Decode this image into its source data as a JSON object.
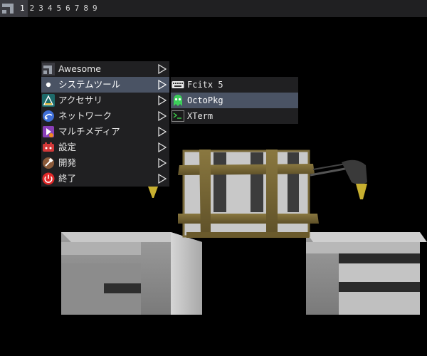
{
  "wibar": {
    "tags": [
      "1",
      "2",
      "3",
      "4",
      "5",
      "6",
      "7",
      "8",
      "9"
    ],
    "active_tag": "1"
  },
  "main_menu": {
    "items": [
      {
        "label": "Awesome",
        "icon": "awesome-icon"
      },
      {
        "label": "システムツール",
        "icon": "bullet-icon"
      },
      {
        "label": "アクセサリ",
        "icon": "accessories-icon"
      },
      {
        "label": "ネットワーク",
        "icon": "network-icon"
      },
      {
        "label": "マルチメディア",
        "icon": "multimedia-icon"
      },
      {
        "label": "設定",
        "icon": "settings-icon"
      },
      {
        "label": "開発",
        "icon": "development-icon"
      },
      {
        "label": "終了",
        "icon": "power-icon"
      }
    ],
    "selected": "システムツール"
  },
  "submenu": {
    "items": [
      {
        "label": "Fcitx 5",
        "icon": "keyboard-icon"
      },
      {
        "label": "OctoPkg",
        "icon": "octopkg-icon"
      },
      {
        "label": "XTerm",
        "icon": "terminal-icon"
      }
    ],
    "selected": "OctoPkg"
  },
  "colors": {
    "bar": "#202022",
    "menu_bg": "#202022",
    "selection": "#4a5364",
    "text": "#e6e6e6"
  }
}
